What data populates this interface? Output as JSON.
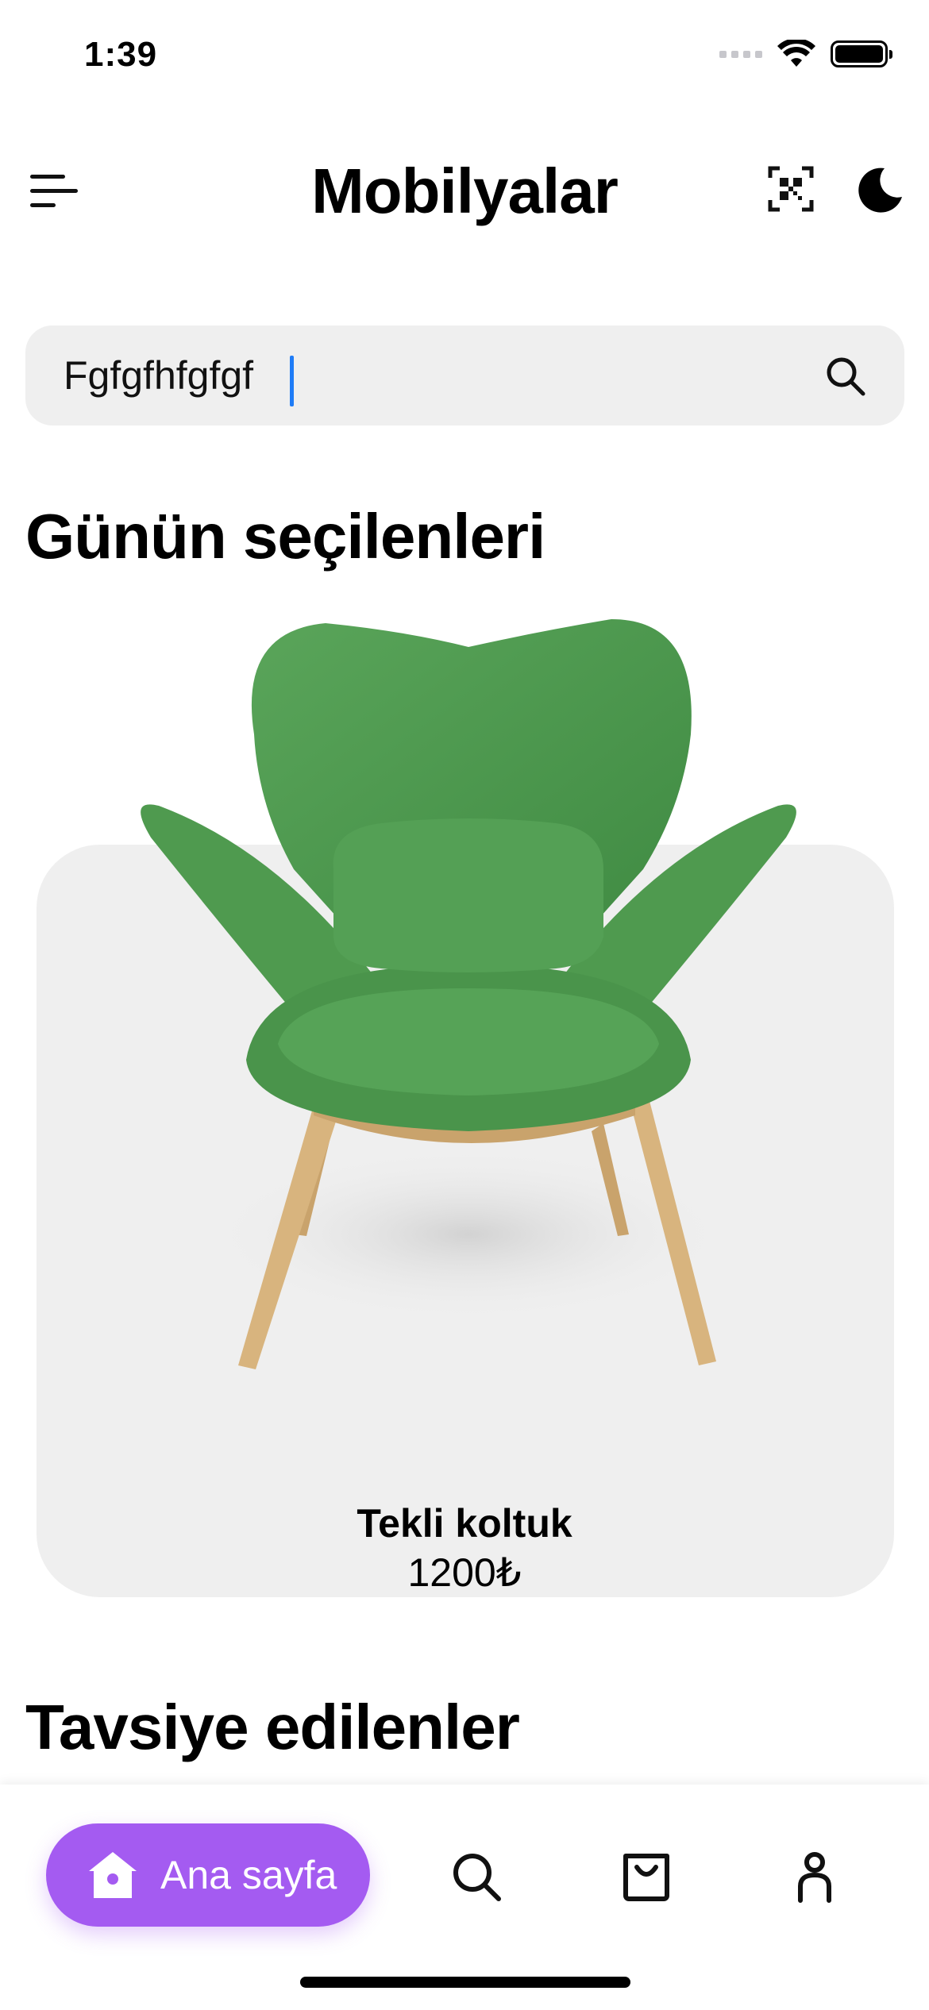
{
  "status_bar": {
    "time": "1:39"
  },
  "header": {
    "title": "Mobilyalar",
    "menu_icon": "menu-icon",
    "scan_icon": "qr-scan-icon",
    "theme_icon": "moon-icon"
  },
  "search": {
    "value": "Fgfgfhfgfgf",
    "icon": "search-icon"
  },
  "sections": {
    "daily_picks_title": "Günün seçilenleri",
    "recommended_title": "Tavsiye edilenler"
  },
  "featured_product": {
    "name": "Tekli koltuk",
    "price": "1200₺",
    "image": "green-armchair-image"
  },
  "bottom_nav": {
    "home_label": "Ana sayfa",
    "items": [
      "home-icon",
      "search-icon",
      "shopping-bag-icon",
      "profile-icon"
    ]
  },
  "colors": {
    "accent": "#a45bf1",
    "search_background": "#efefef",
    "card_background": "#efefef",
    "caret": "#1f7cf7",
    "chair_green": "#4f9a4f",
    "chair_wood": "#d8b47e"
  }
}
